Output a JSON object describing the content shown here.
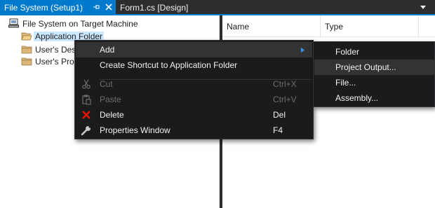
{
  "tabs": {
    "active_label": "File System (Setup1)",
    "inactive_label": "Form1.cs [Design]"
  },
  "tree": {
    "root": "File System on Target Machine",
    "items": [
      "Application Folder",
      "User's Desktop",
      "User's Programs Menu"
    ]
  },
  "list": {
    "columns": [
      "Name",
      "Type"
    ]
  },
  "context_menu": {
    "items": [
      {
        "label": "Add",
        "shortcut": "",
        "icon": "none",
        "enabled": true,
        "submenu": true
      },
      {
        "label": "Create Shortcut to Application Folder",
        "shortcut": "",
        "icon": "none",
        "enabled": true
      },
      {
        "label": "Cut",
        "shortcut": "Ctrl+X",
        "icon": "scissors-icon",
        "enabled": false
      },
      {
        "label": "Paste",
        "shortcut": "Ctrl+V",
        "icon": "paste-icon",
        "enabled": false
      },
      {
        "label": "Delete",
        "shortcut": "Del",
        "icon": "delete-x-icon",
        "enabled": true
      },
      {
        "label": "Properties Window",
        "shortcut": "F4",
        "icon": "wrench-icon",
        "enabled": true
      }
    ]
  },
  "submenu": {
    "items": [
      "Folder",
      "Project Output...",
      "File...",
      "Assembly..."
    ]
  },
  "colors": {
    "accent": "#007acc",
    "menu_bg": "#1b1b1c",
    "delete_red": "#e51400",
    "selection": "#cce8ff"
  }
}
